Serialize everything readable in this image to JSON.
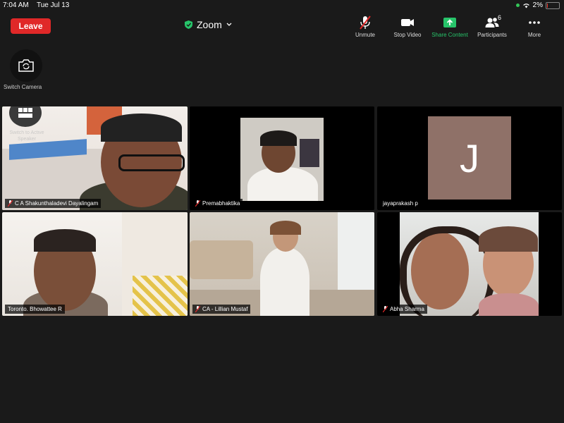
{
  "status_bar": {
    "time": "7:04 AM",
    "date": "Tue Jul 13",
    "battery": "2%"
  },
  "header": {
    "leave_label": "Leave",
    "meeting_title": "Zoom"
  },
  "toolbar": {
    "unmute": "Unmute",
    "stop_video": "Stop Video",
    "share_content": "Share Content",
    "participants": "Participants",
    "participants_count": "6",
    "more": "More"
  },
  "switch_camera": "Switch Camera",
  "active_speaker": "Switch to Active Speaker",
  "participants": [
    {
      "name": "C A Shakunthaladevi Dayalingam",
      "muted": true
    },
    {
      "name": "Premabhaktika",
      "muted": true
    },
    {
      "name": "jayaprakash p",
      "muted": false,
      "initial": "J"
    },
    {
      "name": "Toronto. Bhowattee R",
      "muted": false
    },
    {
      "name": "CA - Lillian Mustaf",
      "muted": true
    },
    {
      "name": "Abha Sharma",
      "muted": true
    }
  ],
  "colors": {
    "leave": "#e02828",
    "share": "#27c46a",
    "active_border": "#2fcf4c",
    "avatar_bg": "#8f7168"
  }
}
